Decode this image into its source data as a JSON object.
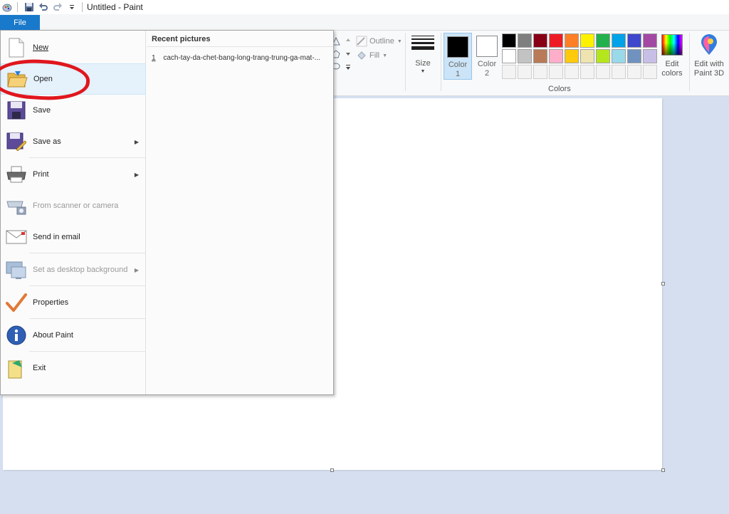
{
  "window": {
    "title": "Untitled - Paint"
  },
  "file_tab": {
    "label": "File"
  },
  "file_menu": {
    "items": [
      {
        "label": "New"
      },
      {
        "label": "Open"
      },
      {
        "label": "Save"
      },
      {
        "label": "Save as"
      },
      {
        "label": "Print"
      },
      {
        "label": "From scanner or camera"
      },
      {
        "label": "Send in email"
      },
      {
        "label": "Set as desktop background"
      },
      {
        "label": "Properties"
      },
      {
        "label": "About Paint"
      },
      {
        "label": "Exit"
      }
    ],
    "recent": {
      "title": "Recent pictures",
      "items": [
        {
          "num": "1",
          "name": "cach-tay-da-chet-bang-long-trang-trung-ga-mat-..."
        }
      ]
    }
  },
  "ribbon": {
    "outline_label": "Outline",
    "fill_label": "Fill",
    "size_label": "Size",
    "color1_label": "Color 1",
    "color2_label": "Color 2",
    "colors_group_label": "Colors",
    "edit_colors_label": "Edit colors",
    "edit_paint3d_label": "Edit with Paint 3D",
    "color1_value": "#000000",
    "color2_value": "#ffffff",
    "palette_row1": [
      "#000000",
      "#7f7f7f",
      "#880015",
      "#ed1c24",
      "#ff7f27",
      "#fff200",
      "#22b14c",
      "#00a2e8",
      "#3f48cc",
      "#a349a4"
    ],
    "palette_row2": [
      "#ffffff",
      "#c3c3c3",
      "#b97a57",
      "#ffaec9",
      "#ffc90e",
      "#efe4b0",
      "#b5e61d",
      "#99d9ea",
      "#7092be",
      "#c8bfe7"
    ]
  },
  "annotation": {
    "color": "#e0161d"
  }
}
